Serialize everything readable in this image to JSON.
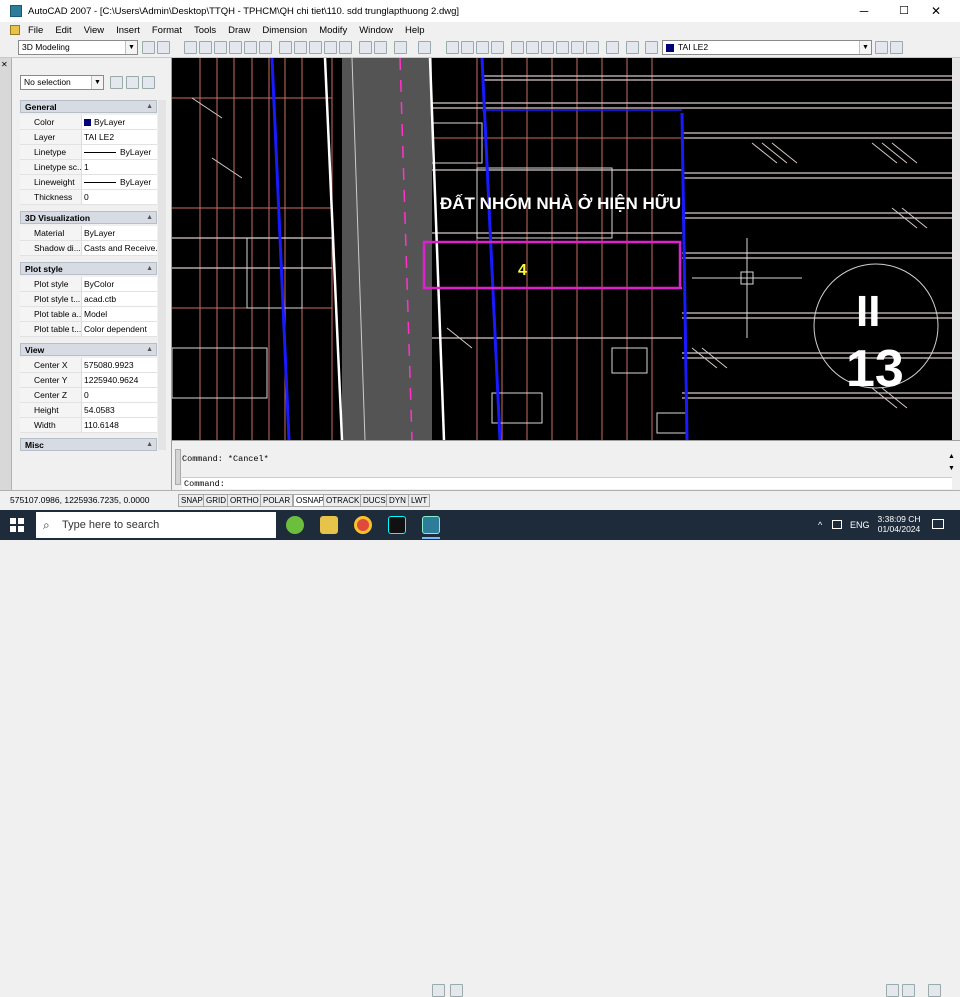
{
  "window": {
    "title": "AutoCAD 2007 - [C:\\Users\\Admin\\Desktop\\TTQH - TPHCM\\QH chi tiet\\110. sdd trunglapthuong 2.dwg]",
    "minimize": "─",
    "maximize": "☐",
    "close": "✕"
  },
  "menu": [
    "File",
    "Edit",
    "View",
    "Insert",
    "Format",
    "Tools",
    "Draw",
    "Dimension",
    "Modify",
    "Window",
    "Help"
  ],
  "toolbar": {
    "workspace": "3D Modeling",
    "layer": "TAI LE2"
  },
  "properties": {
    "selection": "No selection",
    "sections": {
      "general": "General",
      "viz3d": "3D Visualization",
      "plot": "Plot style",
      "view": "View",
      "misc": "Misc"
    },
    "general": [
      {
        "k": "Color",
        "v": "ByLayer"
      },
      {
        "k": "Layer",
        "v": "TAI LE2"
      },
      {
        "k": "Linetype",
        "v": "ByLayer"
      },
      {
        "k": "Linetype sc...",
        "v": "1"
      },
      {
        "k": "Lineweight",
        "v": "ByLayer"
      },
      {
        "k": "Thickness",
        "v": "0"
      }
    ],
    "viz3d": [
      {
        "k": "Material",
        "v": "ByLayer"
      },
      {
        "k": "Shadow di...",
        "v": "Casts and Receive..."
      }
    ],
    "plot": [
      {
        "k": "Plot style",
        "v": "ByColor"
      },
      {
        "k": "Plot style t...",
        "v": "acad.ctb"
      },
      {
        "k": "Plot table a...",
        "v": "Model"
      },
      {
        "k": "Plot table t...",
        "v": "Color dependent"
      }
    ],
    "view": [
      {
        "k": "Center X",
        "v": "575080.9923"
      },
      {
        "k": "Center Y",
        "v": "1225940.9624"
      },
      {
        "k": "Center Z",
        "v": "0"
      },
      {
        "k": "Height",
        "v": "54.0583"
      },
      {
        "k": "Width",
        "v": "110.6148"
      }
    ]
  },
  "drawing": {
    "label": "ĐẤT NHÓM NHÀ Ở HIỆN HỮU",
    "lot_number": "4",
    "zone_roman": "II",
    "zone_number": "13",
    "colors": {
      "background": "#000000",
      "road_line": "#ffffff",
      "blue_line": "#1a1aff",
      "magenta": "#ff33cc",
      "lot_box": "#e020d0",
      "lot_number": "#ffff33",
      "grid": "#c87060",
      "hatch": "#d8c8c8"
    }
  },
  "command": {
    "history": "Command: *Cancel*",
    "prompt": "Command:"
  },
  "status": {
    "coords": "575107.0986, 1225936.7235, 0.0000",
    "toggles": [
      "SNAP",
      "GRID",
      "ORTHO",
      "POLAR",
      "OSNAP",
      "OTRACK",
      "DUCS",
      "DYN",
      "LWT"
    ]
  },
  "taskbar": {
    "search_placeholder": "Type here to search",
    "lang": "ENG",
    "time": "3:38:09 CH",
    "date": "01/04/2024"
  }
}
